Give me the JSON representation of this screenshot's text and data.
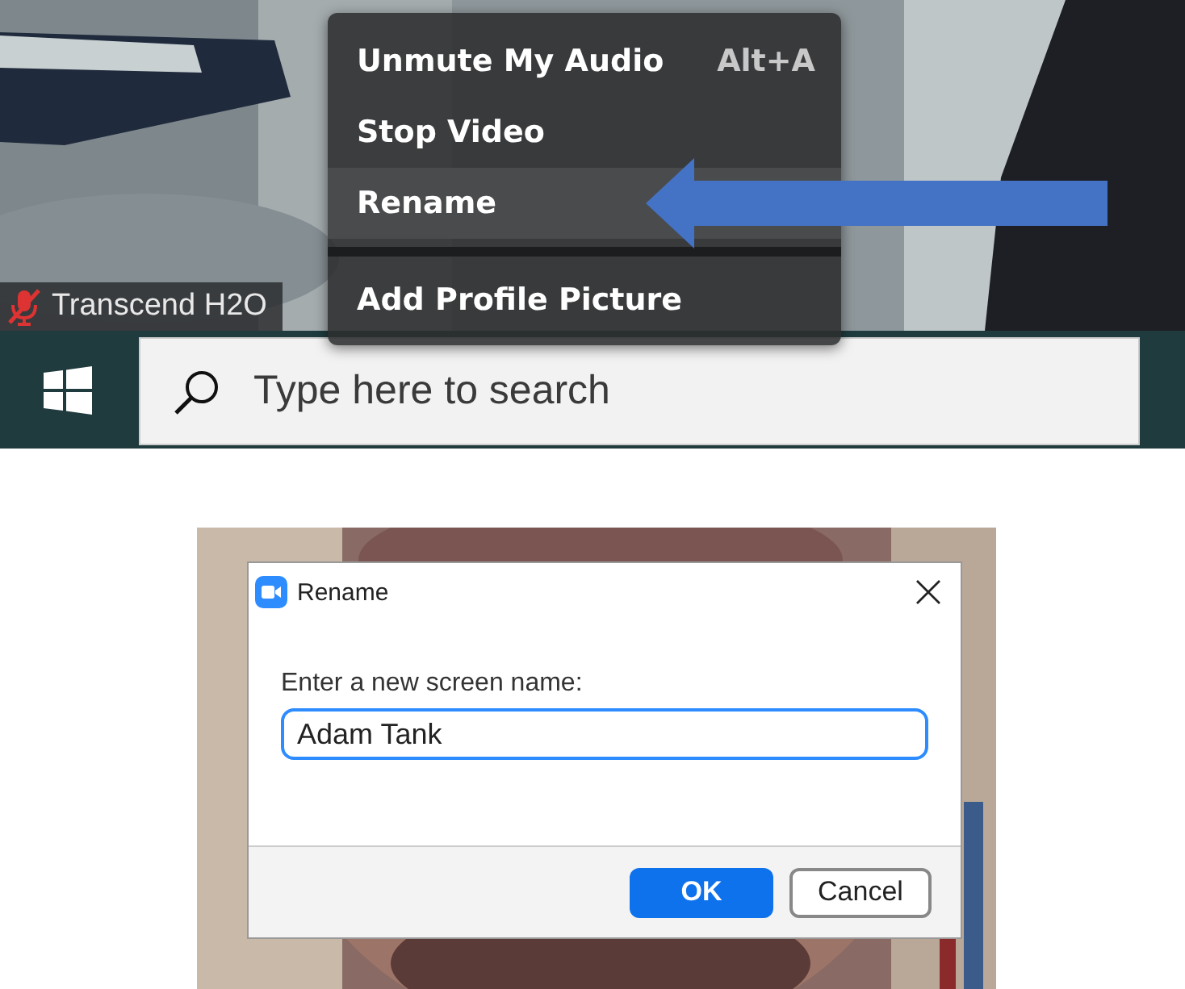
{
  "menu": {
    "items": [
      {
        "kind": "item",
        "label": "Unmute My Audio",
        "shortcut": "Alt+A",
        "selected": false
      },
      {
        "kind": "item",
        "label": "Stop Video",
        "selected": false
      },
      {
        "kind": "item",
        "label": "Rename",
        "selected": true
      },
      {
        "kind": "separator"
      },
      {
        "kind": "item",
        "label": "Add Profile Picture",
        "selected": false
      }
    ]
  },
  "name_tag": {
    "name": "Transcend H2O",
    "muted": true
  },
  "taskbar": {
    "search": {
      "placeholder": "Type here to search"
    }
  },
  "dialog": {
    "title": "Rename",
    "prompt": "Enter a new screen name:",
    "input": {
      "value": "Adam Tank",
      "focused": true
    },
    "buttons": [
      {
        "label": "OK",
        "primary": true
      },
      {
        "label": "Cancel",
        "primary": false
      }
    ]
  }
}
